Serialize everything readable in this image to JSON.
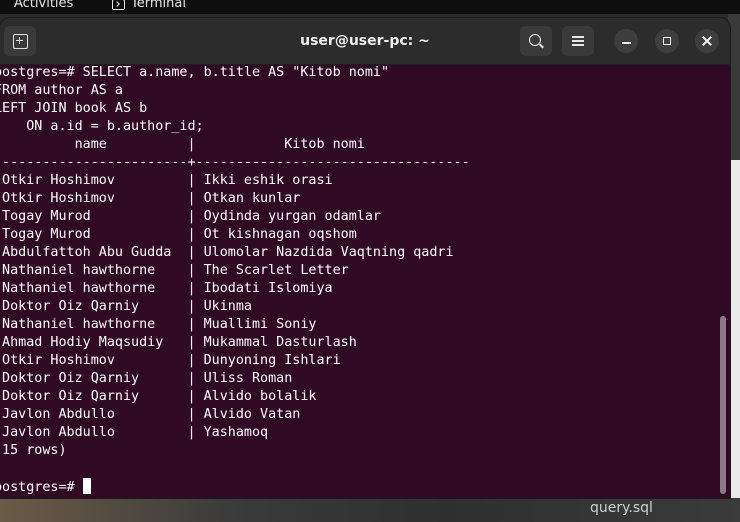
{
  "topbar": {
    "activities": "Activities",
    "app_name": "Terminal"
  },
  "window": {
    "title": "user@user-pc: ~"
  },
  "terminal": {
    "lines": [
      "postgres=# SELECT a.name, b.title AS \"Kitob nomi\"",
      "FROM author AS a",
      "LEFT JOIN book AS b",
      "    ON a.id = b.author_id;",
      "          name          |           Kitob nomi",
      "------------------------+----------------------------------",
      " Otkir Hoshimov         | Ikki eshik orasi",
      " Otkir Hoshimov         | Otkan kunlar",
      " Togay Murod            | Oydinda yurgan odamlar",
      " Togay Murod            | Ot kishnagan oqshom",
      " Abdulfattoh Abu Gudda  | Ulomolar Nazdida Vaqtning qadri",
      " Nathaniel hawthorne    | The Scarlet Letter",
      " Nathaniel hawthorne    | Ibodati Islomiya",
      " Doktor Oiz Qarniy      | Ukinma",
      " Nathaniel hawthorne    | Muallimi Soniy",
      " Ahmad Hodiy Maqsudiy   | Mukammal Dasturlash",
      " Otkir Hoshimov         | Dunyoning Ishlari",
      " Doktor Oiz Qarniy      | Uliss Roman",
      " Doktor Oiz Qarniy      | Alvido bolalik",
      " Javlon Abdullo         | Alvido Vatan",
      " Javlon Abdullo         | Yashamoq",
      "(15 rows)",
      "",
      "postgres=# "
    ]
  },
  "background": {
    "file_label": "query.sql"
  }
}
